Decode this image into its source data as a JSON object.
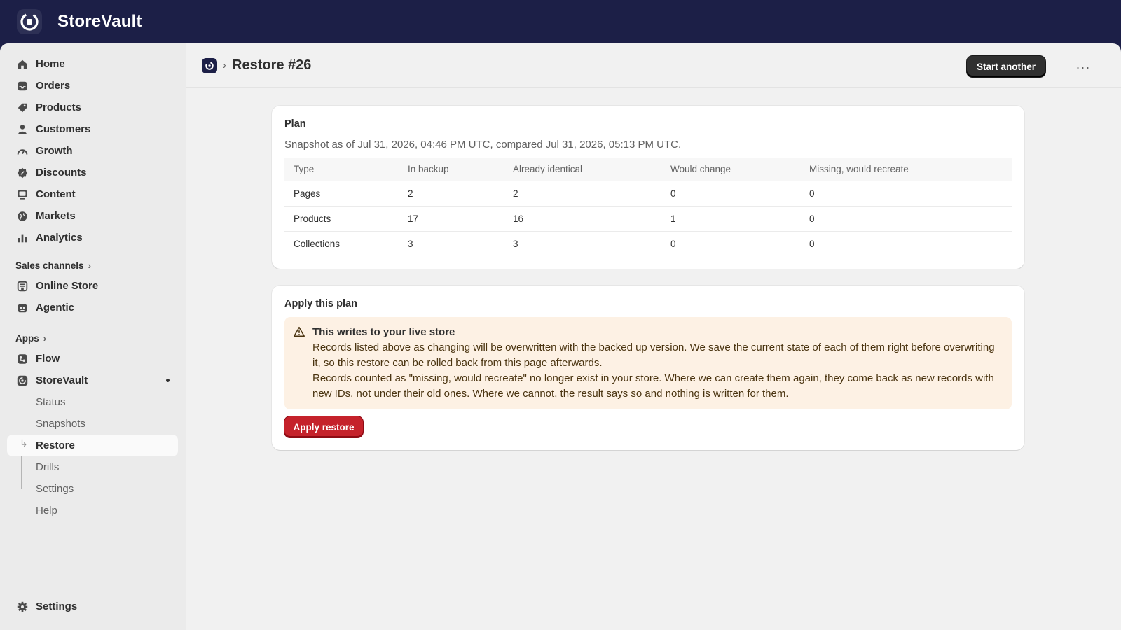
{
  "app": {
    "name": "StoreVault"
  },
  "sidebar": {
    "items": [
      {
        "label": "Home",
        "icon": "home-icon"
      },
      {
        "label": "Orders",
        "icon": "inbox-icon"
      },
      {
        "label": "Products",
        "icon": "tag-icon"
      },
      {
        "label": "Customers",
        "icon": "person-icon"
      },
      {
        "label": "Growth",
        "icon": "gauge-icon"
      },
      {
        "label": "Discounts",
        "icon": "discount-icon"
      },
      {
        "label": "Content",
        "icon": "content-icon"
      },
      {
        "label": "Markets",
        "icon": "globe-icon"
      },
      {
        "label": "Analytics",
        "icon": "bar-chart-icon"
      }
    ],
    "sales_channels_label": "Sales channels",
    "channels": [
      {
        "label": "Online Store",
        "icon": "store-icon"
      },
      {
        "label": "Agentic",
        "icon": "robot-icon"
      }
    ],
    "apps_label": "Apps",
    "apps": [
      {
        "label": "Flow",
        "icon": "flow-icon"
      },
      {
        "label": "StoreVault",
        "icon": "storevault-icon"
      }
    ],
    "storevault_sub": [
      "Status",
      "Snapshots",
      "Restore",
      "Drills",
      "Settings",
      "Help"
    ],
    "active_sub": "Restore",
    "settings_label": "Settings"
  },
  "header": {
    "title": "Restore #26",
    "primary_button": "Start another",
    "more_label": "···"
  },
  "plan": {
    "title": "Plan",
    "subtitle": "Snapshot as of Jul 31, 2026, 04:46 PM UTC, compared Jul 31, 2026, 05:13 PM UTC.",
    "columns": [
      "Type",
      "In backup",
      "Already identical",
      "Would change",
      "Missing, would recreate"
    ],
    "rows": [
      [
        "Pages",
        "2",
        "2",
        "0",
        "0"
      ],
      [
        "Products",
        "17",
        "16",
        "1",
        "0"
      ],
      [
        "Collections",
        "3",
        "3",
        "0",
        "0"
      ]
    ]
  },
  "apply": {
    "title": "Apply this plan",
    "banner_title": "This writes to your live store",
    "banner_p1": "Records listed above as changing will be overwritten with the backed up version. We save the current state of each of them right before overwriting it, so this restore can be rolled back from this page afterwards.",
    "banner_p2": "Records counted as \"missing, would recreate\" no longer exist in your store. Where we can create them again, they come back as new records with new IDs, not under their old ones. Where we cannot, the result says so and nothing is written for them.",
    "button": "Apply restore"
  },
  "colors": {
    "topbar": "#1c1f47",
    "danger": "#c5222b",
    "warning_bg": "#fdf1e4"
  }
}
